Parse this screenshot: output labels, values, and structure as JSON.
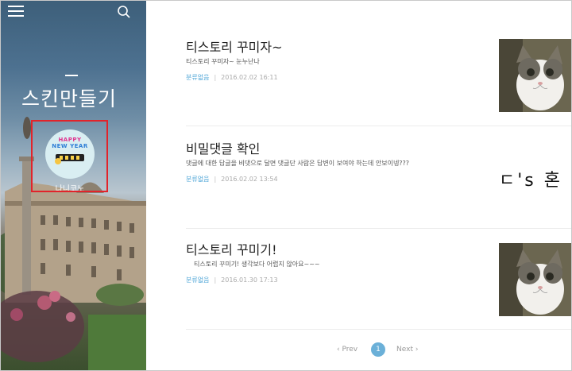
{
  "sidebar": {
    "blog_title": "스킨만들기",
    "nickname": "나니코노",
    "avatar": {
      "line1": "HAPPY",
      "line2": "NEW YEAR"
    },
    "menu_icon": "hamburger-icon",
    "search_icon": "search-icon"
  },
  "posts": [
    {
      "title": "티스토리 꾸미자~",
      "excerpt": "티스토리 꾸미자~ 눈누난나",
      "category": "분류없음",
      "date": "2016.02.02 16:11",
      "thumbnail": "cat-photo"
    },
    {
      "title": "비밀댓글 확인",
      "excerpt": "댓글에 대한 답글을 비댓으로 달면 댓글단 사람은 답변이 보여야 하는데 안보이넹???",
      "category": "분류없음",
      "date": "2016.02.02 13:54",
      "thumbnail": "handwriting-text",
      "thumb_text": "ㄷ's 혼"
    },
    {
      "title": "티스토리 꾸미기!",
      "excerpt": "티스토리 꾸미기! 생각보다 어렵지 않아요~~~",
      "category": "분류없음",
      "date": "2016.01.30 17:13",
      "thumbnail": "cat-photo"
    }
  ],
  "pagination": {
    "prev_label": "‹ Prev",
    "current_page": "1",
    "next_label": "Next ›"
  },
  "colors": {
    "accent": "#4aa3d6",
    "page_active": "#6bb0d8",
    "highlight_border": "#e2232a"
  }
}
